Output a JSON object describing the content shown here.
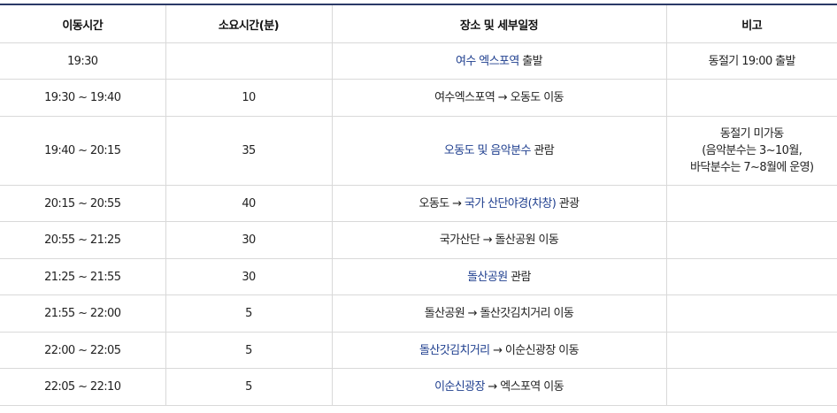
{
  "table": {
    "headers": [
      "이동시간",
      "소요시간(분)",
      "장소 및 세부일정",
      "비고"
    ],
    "rows": [
      {
        "time": "19:30",
        "duration": "",
        "schedule": [
          {
            "text": "여수 엑스포역",
            "highlight": true
          },
          {
            "text": " 출발",
            "highlight": false
          }
        ],
        "note": [
          "동절기 19:00 출발"
        ]
      },
      {
        "time": "19:30 ~ 19:40",
        "duration": "10",
        "schedule": [
          {
            "text": "여수엑스포역 → 오동도 이동",
            "highlight": false
          }
        ],
        "note": []
      },
      {
        "time": "19:40 ~ 20:15",
        "duration": "35",
        "schedule": [
          {
            "text": "오동도 및 음악분수",
            "highlight": true
          },
          {
            "text": " 관람",
            "highlight": false
          }
        ],
        "note": [
          "동절기 미가동",
          "(음악분수는 3~10월,",
          "바닥분수는 7~8월에 운영)"
        ]
      },
      {
        "time": "20:15 ~ 20:55",
        "duration": "40",
        "schedule": [
          {
            "text": "오동도 → ",
            "highlight": false
          },
          {
            "text": "국가 산단야경(차창)",
            "highlight": true
          },
          {
            "text": " 관광",
            "highlight": false
          }
        ],
        "note": []
      },
      {
        "time": "20:55 ~ 21:25",
        "duration": "30",
        "schedule": [
          {
            "text": "국가산단 → 돌산공원 이동",
            "highlight": false
          }
        ],
        "note": []
      },
      {
        "time": "21:25 ~ 21:55",
        "duration": "30",
        "schedule": [
          {
            "text": "돌산공원",
            "highlight": true
          },
          {
            "text": " 관람",
            "highlight": false
          }
        ],
        "note": []
      },
      {
        "time": "21:55 ~ 22:00",
        "duration": "5",
        "schedule": [
          {
            "text": "돌산공원 → 돌산갓김치거리 이동",
            "highlight": false
          }
        ],
        "note": []
      },
      {
        "time": "22:00 ~ 22:05",
        "duration": "5",
        "schedule": [
          {
            "text": "돌산갓김치거리",
            "highlight": true
          },
          {
            "text": " → 이순신광장 이동",
            "highlight": false
          }
        ],
        "note": []
      },
      {
        "time": "22:05 ~ 22:10",
        "duration": "5",
        "schedule": [
          {
            "text": "이순신광장",
            "highlight": true
          },
          {
            "text": " → 엑스포역 이동",
            "highlight": false
          }
        ],
        "note": []
      }
    ]
  }
}
